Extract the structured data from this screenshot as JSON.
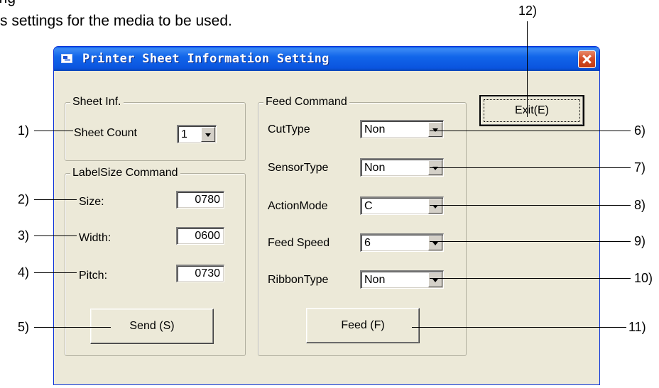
{
  "doc": {
    "line_partial": "",
    "line2": "s settings for the media to be used."
  },
  "window": {
    "title": "Printer Sheet Information Setting"
  },
  "sheet_inf": {
    "legend": "Sheet Inf.",
    "sheet_count_label": "Sheet Count",
    "sheet_count_value": "1"
  },
  "label_size": {
    "legend": "LabelSize Command",
    "size_label": "Size:",
    "size_value": "0780",
    "width_label": "Width:",
    "width_value": "0600",
    "pitch_label": "Pitch:",
    "pitch_value": "0730",
    "send_button": "Send (S)"
  },
  "feed_command": {
    "legend": "Feed Command",
    "cut_type_label": "CutType",
    "cut_type_value": "Non",
    "sensor_type_label": "SensorType",
    "sensor_type_value": "Non",
    "action_mode_label": "ActionMode",
    "action_mode_value": "C",
    "feed_speed_label": "Feed Speed",
    "feed_speed_value": "6",
    "ribbon_type_label": "RibbonType",
    "ribbon_type_value": "Non",
    "feed_button": "Feed (F)"
  },
  "exit_button": "Exit(E)",
  "callouts": {
    "c1": "1)",
    "c2": "2)",
    "c3": "3)",
    "c4": "4)",
    "c5": "5)",
    "c6": "6)",
    "c7": "7)",
    "c8": "8)",
    "c9": "9)",
    "c10": "10)",
    "c11": "11)",
    "c12": "12)"
  },
  "icons": {
    "title": "window-app-icon",
    "close": "close-icon",
    "dropdown": "chevron-down-icon"
  },
  "colors": {
    "titlebar": "#0a54df",
    "window_bg": "#ece9d8",
    "close_button": "#d5502a"
  }
}
